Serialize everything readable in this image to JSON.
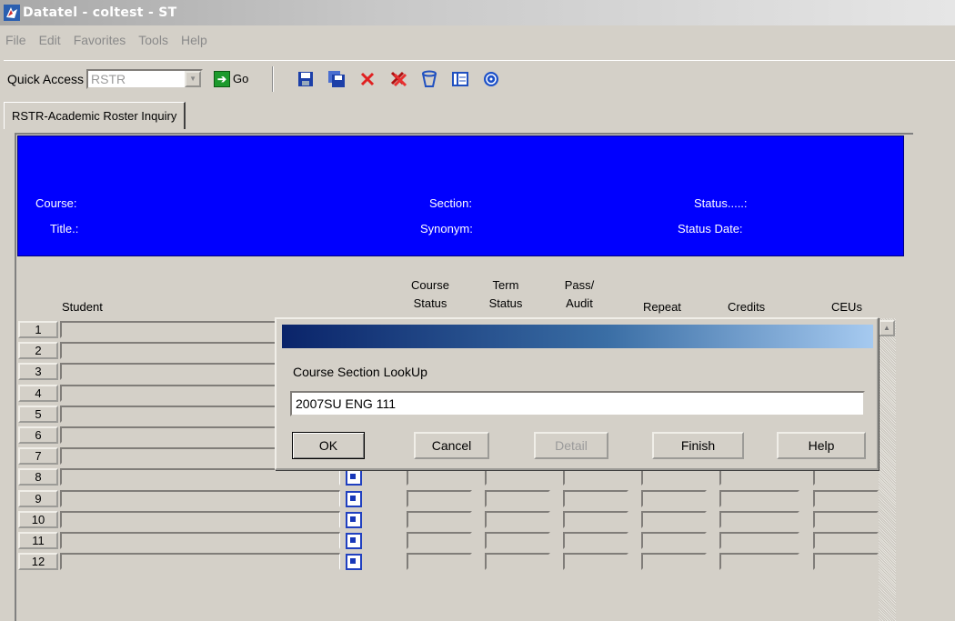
{
  "window": {
    "title": "Datatel - coltest - ST"
  },
  "menu": [
    "File",
    "Edit",
    "Favorites",
    "Tools",
    "Help"
  ],
  "toolbar": {
    "quick_access_label": "Quick Access",
    "quick_access_value": "RSTR",
    "go_label": "Go",
    "icons": [
      "save-icon",
      "save-all-icon",
      "cancel-icon",
      "cancel-all-icon",
      "delete-icon",
      "form-icon",
      "help-icon"
    ]
  },
  "tab": {
    "label": "RSTR-Academic Roster Inquiry"
  },
  "header": {
    "course_label": "Course:",
    "title_label": "Title.:",
    "section_label": "Section:",
    "synonym_label": "Synonym:",
    "status_label": "Status.....:",
    "status_date_label": "Status Date:",
    "background": "#0000ff"
  },
  "columns": {
    "student": "Student",
    "course_status": [
      "Course",
      "Status"
    ],
    "term_status": [
      "Term",
      "Status"
    ],
    "pass_audit": [
      "Pass/",
      "Audit"
    ],
    "repeat": "Repeat",
    "credits": "Credits",
    "ceus": "CEUs"
  },
  "rows": [
    "1",
    "2",
    "3",
    "4",
    "5",
    "6",
    "7",
    "8",
    "9",
    "10",
    "11",
    "12"
  ],
  "dialog": {
    "label": "Course Section LookUp",
    "input_value": "2007SU ENG 111",
    "buttons": {
      "ok": "OK",
      "cancel": "Cancel",
      "detail": "Detail",
      "finish": "Finish",
      "help": "Help"
    }
  }
}
